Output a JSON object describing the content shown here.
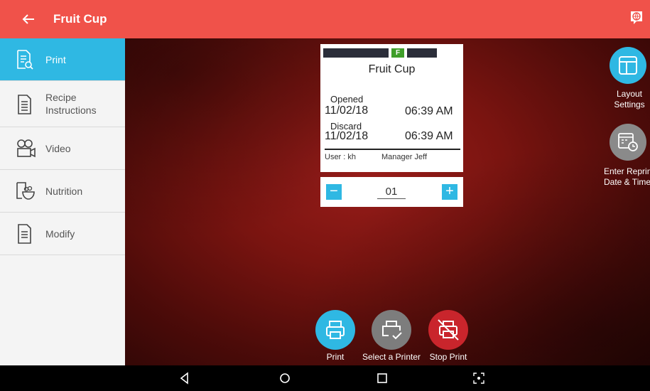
{
  "header": {
    "title": "Fruit Cup",
    "back_icon": "arrow-left-icon",
    "lang_icon": "globe-chat-icon"
  },
  "sidebar": {
    "items": [
      {
        "label": "Print",
        "icon": "document-search-icon",
        "active": true
      },
      {
        "label": "Recipe\nInstructions",
        "icon": "document-lines-icon"
      },
      {
        "label": "Video",
        "icon": "video-camera-icon"
      },
      {
        "label": "Nutrition",
        "icon": "nutrition-bowl-icon"
      },
      {
        "label": "Modify",
        "icon": "document-edit-icon"
      }
    ]
  },
  "label_preview": {
    "day_code": "F",
    "title": "Fruit Cup",
    "opened_label": "Opened",
    "opened_date": "11/02/18",
    "opened_time": "06:39 AM",
    "discard_label": "Discard",
    "discard_date": "11/02/18",
    "discard_time": "06:39 AM",
    "user": "User : kh",
    "manager": "Manager Jeff"
  },
  "quantity": {
    "value": "01",
    "minus": "−",
    "plus": "+"
  },
  "right_actions": {
    "layout_settings": "Layout\nSettings",
    "enter_reprint": "Enter Reprint\nDate & Time"
  },
  "bottom_actions": {
    "print": "Print",
    "select_printer": "Select a Printer",
    "stop_print": "Stop Print"
  },
  "colors": {
    "topbar": "#f0524a",
    "accent": "#2fb8e3",
    "grey_button": "#7d7d7d",
    "stop_button": "#c9252c"
  }
}
